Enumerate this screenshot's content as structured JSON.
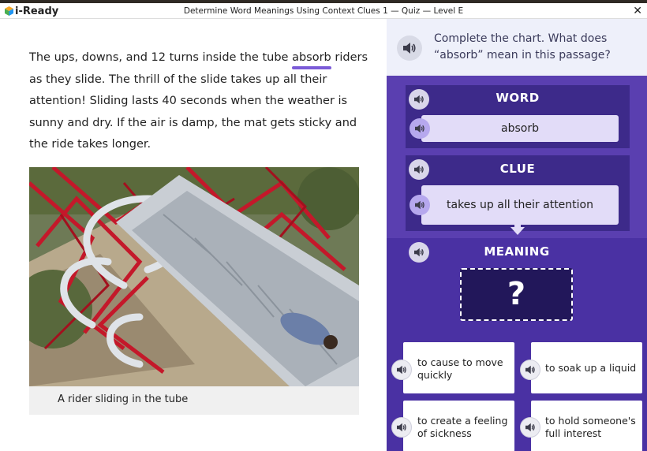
{
  "app": {
    "brand": "i-Ready",
    "title": "Determine Word Meanings Using Context Clues 1 — Quiz — Level E",
    "close_label": "✕"
  },
  "passage": {
    "before": "The ups, downs, and 12 turns inside the tube ",
    "highlight": "absorb",
    "after": " riders as they slide. The thrill of the slide takes up all their attention! Sliding lasts 40 seconds when the weather is sunny and dry. If the air is damp, the mat gets sticky and the ride takes longer."
  },
  "image": {
    "caption": "A rider sliding in the tube"
  },
  "question": {
    "text": "Complete the chart. What does “absorb” mean in this passage?"
  },
  "chart": {
    "word_title": "WORD",
    "word_value": "absorb",
    "clue_title": "CLUE",
    "clue_value": "takes up all their attention",
    "meaning_title": "MEANING",
    "meaning_value": "?"
  },
  "choices": [
    {
      "label": "to cause to move quickly"
    },
    {
      "label": "to soak up a liquid"
    },
    {
      "label": "to create a feeling of sickness"
    },
    {
      "label": "to hold someone's full interest"
    }
  ],
  "colors": {
    "accent": "#5a3fb0",
    "card": "#3d2a8a",
    "pill": "#e2dcf8",
    "highlight": "#7b5bd8"
  },
  "icons": {
    "speaker": "speaker-icon",
    "close": "close-icon"
  }
}
